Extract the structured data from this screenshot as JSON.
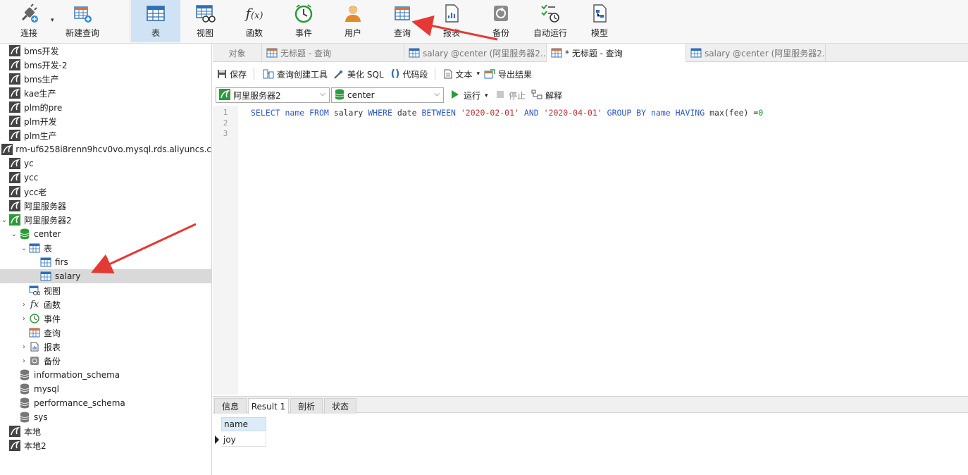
{
  "toolbar": {
    "connect": "连接",
    "new_query": "新建查询",
    "table": "表",
    "view": "视图",
    "function": "函数",
    "event": "事件",
    "user": "用户",
    "query": "查询",
    "report": "报表",
    "backup": "备份",
    "auto_run": "自动运行",
    "model": "模型"
  },
  "sidebar": {
    "connections_top": [
      "bms开发",
      "bms开发-2",
      "bms生产",
      "kae生产",
      "plm的pre",
      "plm开发",
      "plm生产",
      "rm-uf6258i8renn9hcv0vo.mysql.rds.aliyuncs.c",
      "yc",
      "ycc",
      "ycc老",
      "阿里服务器"
    ],
    "open_connection": "阿里服务器2",
    "database": "center",
    "tables_group": "表",
    "tables": [
      "firs",
      "salary"
    ],
    "groups": [
      "视图",
      "函数",
      "事件",
      "查询",
      "报表",
      "备份"
    ],
    "other_dbs": [
      "information_schema",
      "mysql",
      "performance_schema",
      "sys"
    ],
    "connections_bottom": [
      "本地",
      "本地2"
    ]
  },
  "tabs": {
    "objects": "对象",
    "tab1": "无标题 - 查询",
    "tab2": "salary @center (阿里服务器2...",
    "tab3": "* 无标题 - 查询",
    "tab4": "salary @center (阿里服务器2..."
  },
  "editor_toolbar": {
    "save": "保存",
    "query_builder": "查询创建工具",
    "beautify": "美化 SQL",
    "snippet": "代码段",
    "text": "文本",
    "export": "导出结果",
    "run": "运行",
    "stop": "停止",
    "explain": "解释"
  },
  "conn_select": {
    "connection": "阿里服务器2",
    "database": "center"
  },
  "editor": {
    "line_numbers": [
      "1",
      "2",
      "3"
    ],
    "sql": {
      "k_select": "SELECT",
      "id_name": "name",
      "k_from": "FROM",
      "id_salary": "salary",
      "k_where": "WHERE",
      "id_date": "date",
      "k_between": "BETWEEN",
      "s_start": "'2020-02-01'",
      "k_and": "AND",
      "s_end": "'2020-04-01'",
      "k_group": "GROUP BY",
      "id_name2": "name",
      "k_having": "HAVING",
      "id_expr": "max(fee)",
      "op_eq": "=",
      "n_zero": "0"
    }
  },
  "results": {
    "tabs": [
      "信息",
      "Result 1",
      "剖析",
      "状态"
    ],
    "column": "name",
    "rows": [
      "joy"
    ]
  },
  "colors": {
    "keyword": "#2a56c6",
    "string": "#b83232",
    "number": "#0a9a2a",
    "arrow": "#e53935"
  }
}
